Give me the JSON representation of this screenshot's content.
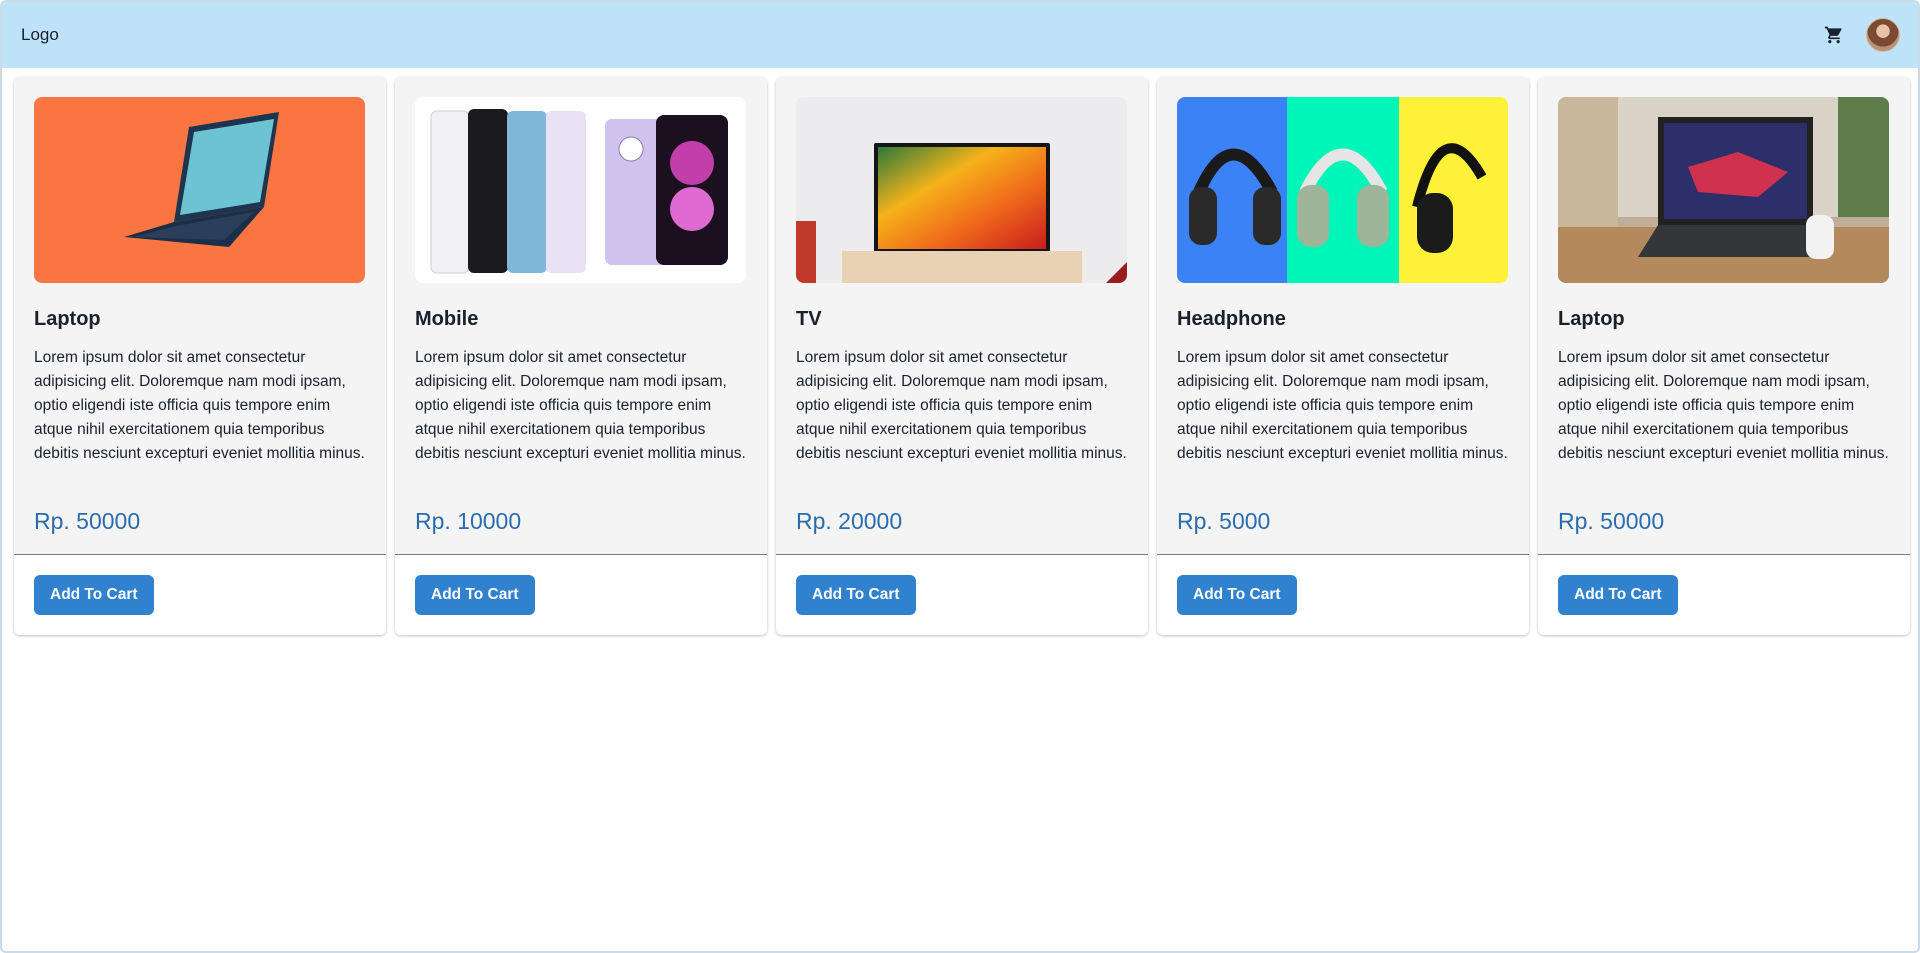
{
  "navbar": {
    "logo": "Logo",
    "cart_icon": "shopping-cart-icon",
    "avatar_icon": "user-avatar",
    "bg_color": "#bee3f8"
  },
  "products": [
    {
      "title": "Laptop",
      "description": "Lorem ipsum dolor sit amet consectetur adipisicing elit. Doloremque nam modi ipsam, optio eligendi iste officia quis tempore enim atque nihil exercitationem quia temporibus debitis nesciunt excepturi eveniet mollitia minus.",
      "price": "Rp. 50000",
      "button_label": "Add To Cart"
    },
    {
      "title": "Mobile",
      "description": "Lorem ipsum dolor sit amet consectetur adipisicing elit. Doloremque nam modi ipsam, optio eligendi iste officia quis tempore enim atque nihil exercitationem quia temporibus debitis nesciunt excepturi eveniet mollitia minus.",
      "price": "Rp. 10000",
      "button_label": "Add To Cart"
    },
    {
      "title": "TV",
      "description": "Lorem ipsum dolor sit amet consectetur adipisicing elit. Doloremque nam modi ipsam, optio eligendi iste officia quis tempore enim atque nihil exercitationem quia temporibus debitis nesciunt excepturi eveniet mollitia minus.",
      "price": "Rp. 20000",
      "button_label": "Add To Cart"
    },
    {
      "title": "Headphone",
      "description": "Lorem ipsum dolor sit amet consectetur adipisicing elit. Doloremque nam modi ipsam, optio eligendi iste officia quis tempore enim atque nihil exercitationem quia temporibus debitis nesciunt excepturi eveniet mollitia minus.",
      "price": "Rp. 5000",
      "button_label": "Add To Cart"
    },
    {
      "title": "Laptop",
      "description": "Lorem ipsum dolor sit amet consectetur adipisicing elit. Doloremque nam modi ipsam, optio eligendi iste officia quis tempore enim atque nihil exercitationem quia temporibus debitis nesciunt excepturi eveniet mollitia minus.",
      "price": "Rp. 50000",
      "button_label": "Add To Cart"
    }
  ],
  "colors": {
    "price": "#2b6cb0",
    "button": "#3182ce",
    "card_bg": "#f4f4f5"
  }
}
